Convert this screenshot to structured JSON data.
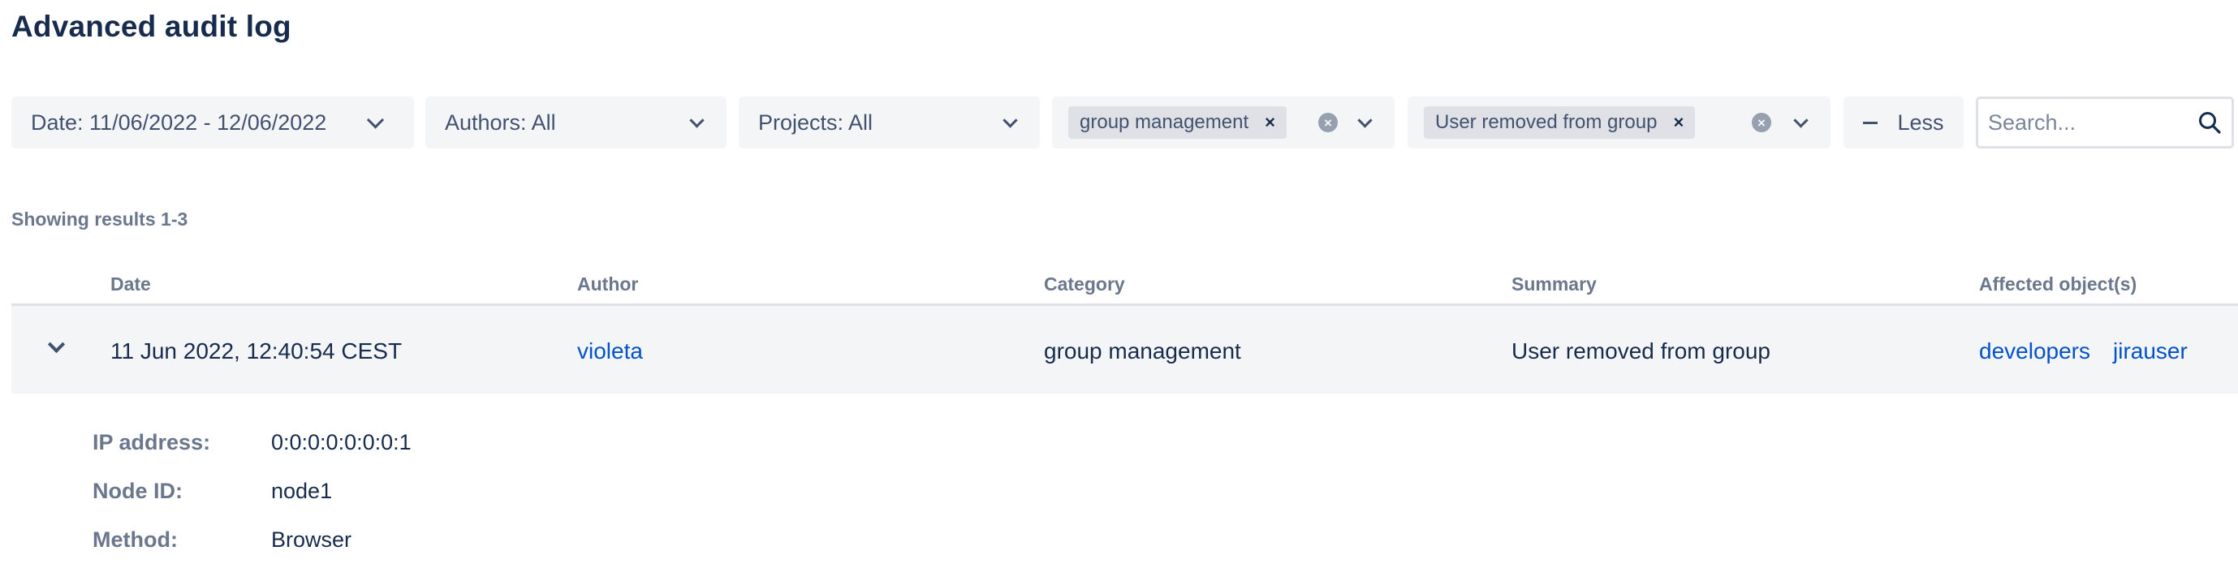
{
  "page": {
    "title": "Advanced audit log"
  },
  "filters": {
    "date": {
      "label": "Date: 11/06/2022 - 12/06/2022"
    },
    "authors": {
      "label": "Authors: All"
    },
    "projects": {
      "label": "Projects: All"
    },
    "category": {
      "chip": "group management",
      "chip_remove": "×",
      "clear": "×"
    },
    "summary": {
      "chip": "User removed from group",
      "chip_remove": "×",
      "clear": "×"
    },
    "less_button": {
      "label": "Less"
    },
    "search": {
      "placeholder": "Search...",
      "value": ""
    }
  },
  "results": {
    "text": "Showing results 1-3"
  },
  "table": {
    "columns": [
      "Date",
      "Author",
      "Category",
      "Summary",
      "Affected object(s)"
    ],
    "rows": [
      {
        "date": "11 Jun 2022, 12:40:54 CEST",
        "author": "violeta",
        "category": "group management",
        "summary": "User removed from group",
        "affected": [
          "developers",
          "jirauser"
        ],
        "expanded": true,
        "details": [
          {
            "label": "IP address:",
            "value": "0:0:0:0:0:0:0:1"
          },
          {
            "label": "Node ID:",
            "value": "node1"
          },
          {
            "label": "Method:",
            "value": "Browser"
          }
        ]
      }
    ]
  },
  "icons": {
    "chevron": "chevron-down-icon",
    "clear": "clear-circle-icon",
    "remove": "remove-x-icon",
    "minus": "minus-icon",
    "search": "search-icon"
  },
  "colors": {
    "link": "#0052cc",
    "text": "#172b4d",
    "muted": "#6b778c",
    "filter_bg": "#f4f5f7",
    "chip_bg": "#dfe1e6"
  }
}
